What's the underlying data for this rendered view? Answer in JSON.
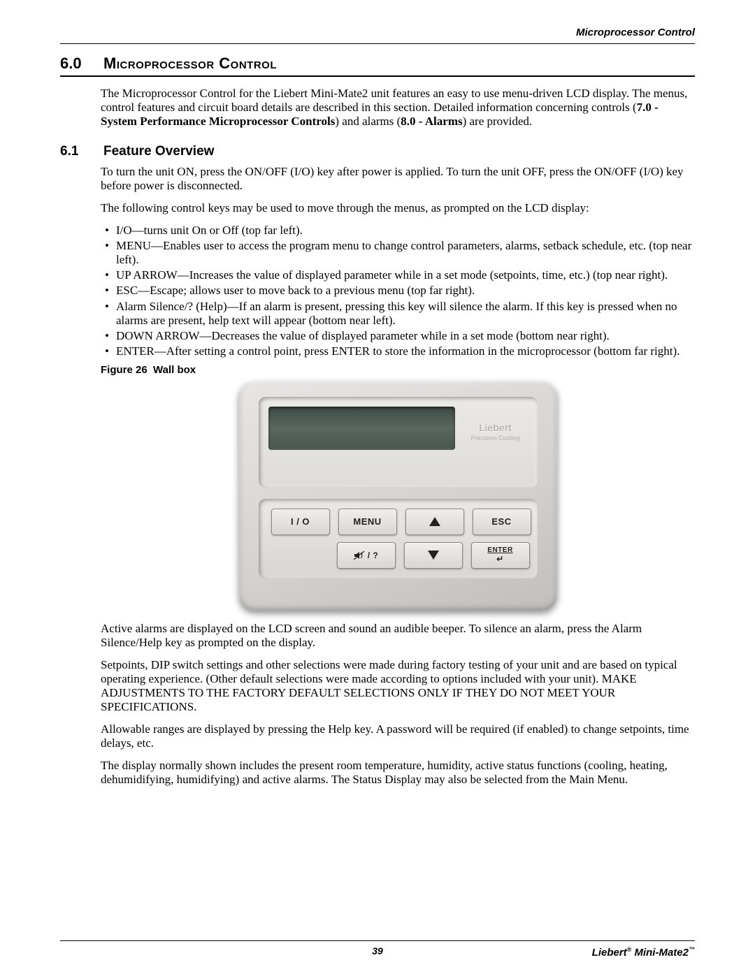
{
  "running_head": "Microprocessor Control",
  "section": {
    "number": "6.0",
    "title": "Microprocessor Control"
  },
  "intro_para_pre": "The Microprocessor Control for the Liebert Mini-Mate2 unit features an easy to use menu-driven LCD display. The menus, control features and circuit board details are described in this section. Detailed information concerning controls (",
  "intro_bold": "7.0 - System Performance Microprocessor Controls",
  "intro_para_mid": ") and alarms (",
  "intro_bold2": "8.0 - Alarms",
  "intro_para_post": ") are provided.",
  "subsection": {
    "number": "6.1",
    "title": "Feature Overview"
  },
  "para_onoff": "To turn the unit ON, press the ON/OFF (I/O) key after power is applied. To turn the unit OFF, press the ON/OFF (I/O) key before power is disconnected.",
  "para_keys_intro": "The following control keys may be used to move through the menus, as prompted on the LCD display:",
  "keys": [
    "I/O—turns unit On or Off (top far left).",
    "MENU—Enables user to access the program menu to change control parameters, alarms, setback schedule, etc. (top near left).",
    "UP ARROW—Increases the value of displayed parameter while in a set mode (setpoints, time, etc.) (top near right).",
    "ESC—Escape; allows user to move back to a previous menu (top far right).",
    "Alarm Silence/? (Help)—If an alarm is present, pressing this key will silence the alarm. If this key is pressed when no alarms are present, help text will appear (bottom near left).",
    "DOWN ARROW—Decreases the value of displayed parameter while in a set mode (bottom near right).",
    "ENTER—After setting a control point, press ENTER to store the information in the microprocessor (bottom far right)."
  ],
  "figure": {
    "label": "Figure 26",
    "title": "Wall box"
  },
  "wallbox": {
    "brand": "Liebert",
    "brand_sub": "Precision Cooling",
    "buttons": {
      "io": "I / O",
      "menu": "MENU",
      "esc": "ESC",
      "silence": "/ ?",
      "enter": "ENTER"
    }
  },
  "para_alarms": "Active alarms are displayed on the LCD screen and sound an audible beeper. To silence an alarm, press the Alarm Silence/Help key as prompted on the display.",
  "para_setpoints": "Setpoints, DIP switch settings and other selections were made during factory testing of your unit and are based on typical operating experience. (Other default selections were made according to options included with your unit). MAKE ADJUSTMENTS TO THE FACTORY DEFAULT SELECTIONS ONLY IF THEY DO NOT MEET YOUR SPECIFICATIONS.",
  "para_ranges": "Allowable ranges are displayed by pressing the Help key. A password will be required (if enabled) to change setpoints, time delays, etc.",
  "para_display": "The display normally shown includes the present room temperature, humidity, active status functions (cooling, heating, dehumidifying, humidifying) and active alarms. The Status Display may also be selected from the Main Menu.",
  "footer": {
    "page": "39",
    "brand_full": "Liebert® Mini-Mate2™",
    "brand_prefix": "Liebert",
    "brand_reg": "®",
    "brand_mid": " Mini-Mate2",
    "brand_tm": "™"
  }
}
